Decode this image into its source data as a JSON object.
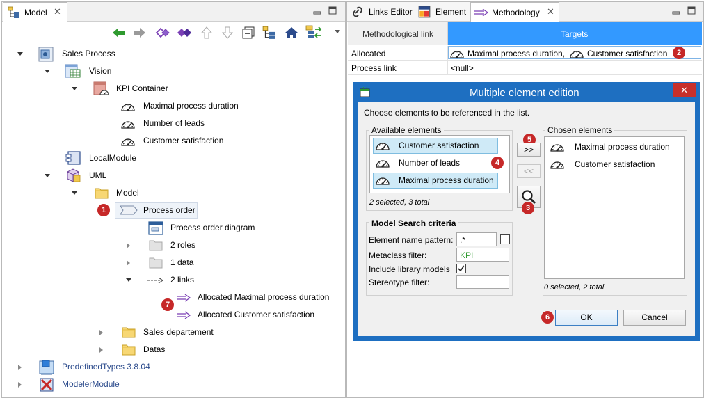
{
  "left_panel": {
    "tab_title": "Model",
    "tree": {
      "sales_process": "Sales Process",
      "vision": "Vision",
      "kpi_container": "KPI Container",
      "kpi_1": "Maximal process duration",
      "kpi_2": "Number of leads",
      "kpi_3": "Customer satisfaction",
      "local_module": "LocalModule",
      "uml": "UML",
      "model": "Model",
      "process_order": "Process order",
      "process_order_diagram": "Process order diagram",
      "roles": "2 roles",
      "data": "1 data",
      "links": "2 links",
      "link_1": "Allocated Maximal process duration",
      "link_2": "Allocated Customer satisfaction",
      "sales_department": "Sales departement",
      "datas": "Datas",
      "predefined_types": "PredefinedTypes 3.8.04",
      "modeler_module": "ModelerModule"
    }
  },
  "right_panel": {
    "tabs": [
      "Links Editor",
      "Element",
      "Methodology"
    ],
    "sub_tabs": [
      "Methodological link",
      "Targets"
    ],
    "properties": {
      "allocated_label": "Allocated",
      "allocated_value_1": "Maximal process duration,",
      "allocated_value_2": "Customer satisfaction",
      "process_link_label": "Process link",
      "process_link_value": "<null>"
    }
  },
  "dialog": {
    "title": "Multiple element edition",
    "instruction": "Choose elements to be referenced in the list.",
    "available_title": "Available elements",
    "available_items": [
      "Customer satisfaction",
      "Number of leads",
      "Maximal process duration"
    ],
    "available_status": "2 selected, 3 total",
    "chosen_title": "Chosen elements",
    "chosen_items": [
      "Maximal process duration",
      "Customer satisfaction"
    ],
    "chosen_status": "0 selected, 2 total",
    "add_button": ">>",
    "remove_button": "<<",
    "search": {
      "title": "Model Search criteria",
      "name_pattern_label": "Element name pattern:",
      "name_pattern_value": ".*",
      "metaclass_label": "Metaclass filter:",
      "metaclass_value": "KPI",
      "include_library_label": "Include library models",
      "stereotype_label": "Stereotype filter:"
    },
    "ok_label": "OK",
    "cancel_label": "Cancel"
  },
  "badges": [
    "1",
    "2",
    "3",
    "4",
    "5",
    "6",
    "7"
  ],
  "colors": {
    "selection_blue": "#3399ff",
    "dialog_blue": "#1e6fc1",
    "badge_red": "#c62828",
    "link_purple": "#7a3fb5",
    "folder_yellow": "#f7d774"
  }
}
